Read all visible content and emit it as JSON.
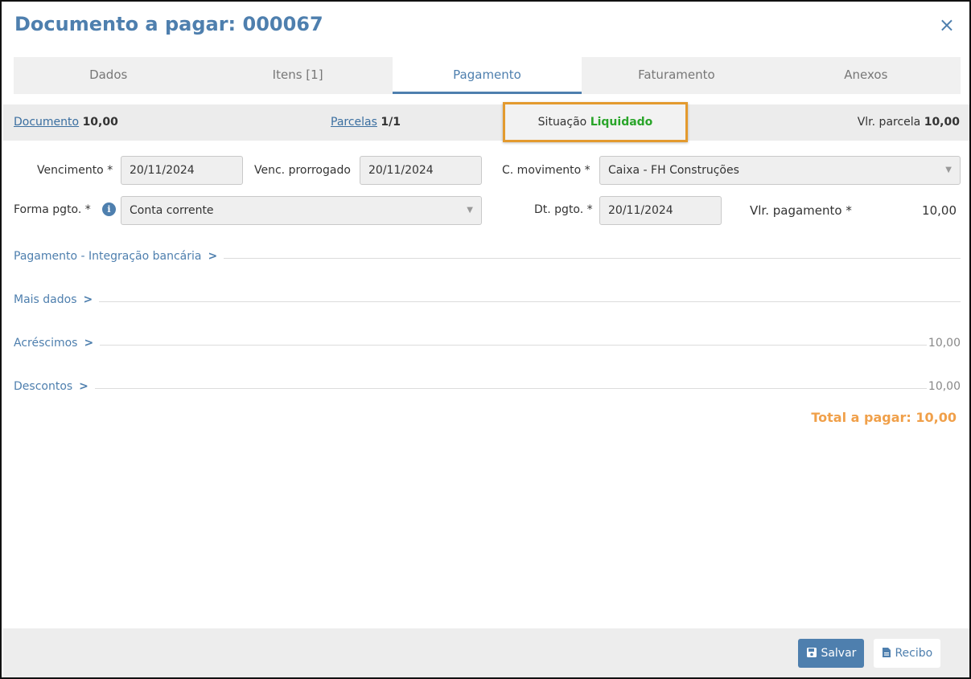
{
  "header": {
    "title": "Documento a pagar: 000067",
    "close": "×"
  },
  "tabs": [
    {
      "label": "Dados"
    },
    {
      "label": "Itens [1]"
    },
    {
      "label": "Pagamento"
    },
    {
      "label": "Faturamento"
    },
    {
      "label": "Anexos"
    }
  ],
  "summary": {
    "documento_label": "Documento",
    "documento_value": "10,00",
    "parcelas_label": "Parcelas",
    "parcelas_value": "1/1",
    "situacao_label": "Situação",
    "situacao_value": "Liquidado",
    "vlr_parcela_label": "Vlr. parcela",
    "vlr_parcela_value": "10,00"
  },
  "form": {
    "vencimento_label": "Vencimento *",
    "vencimento_value": "20/11/2024",
    "venc_prorrogado_label": "Venc. prorrogado",
    "venc_prorrogado_value": "20/11/2024",
    "c_movimento_label": "C. movimento *",
    "c_movimento_value": "Caixa - FH Construções",
    "forma_pgto_label": "Forma pgto. *",
    "forma_pgto_value": "Conta corrente",
    "dt_pgto_label": "Dt. pgto. *",
    "dt_pgto_value": "20/11/2024",
    "vlr_pagamento_label": "Vlr. pagamento *",
    "vlr_pagamento_value": "10,00"
  },
  "sections": {
    "integracao": "Pagamento - Integração bancária",
    "mais_dados": "Mais dados",
    "acrescimos": "Acréscimos",
    "acrescimos_value": "10,00",
    "descontos": "Descontos",
    "descontos_value": "10,00"
  },
  "total": "Total a pagar: 10,00",
  "footer": {
    "save": "Salvar",
    "receipt": "Recibo"
  },
  "colors": {
    "accent": "#4e7fae",
    "success": "#2aa52a",
    "total": "#f0a04a",
    "highlight": "#e39a2e"
  }
}
